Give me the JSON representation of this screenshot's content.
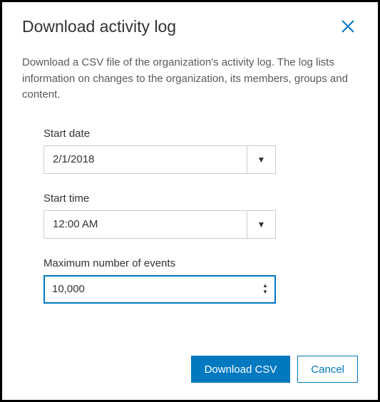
{
  "dialog": {
    "title": "Download activity log",
    "description": "Download a CSV file of the organization's activity log. The log lists information on changes to the organization, its members, groups and content."
  },
  "fields": {
    "start_date": {
      "label": "Start date",
      "value": "2/1/2018"
    },
    "start_time": {
      "label": "Start time",
      "value": "12:00 AM"
    },
    "max_events": {
      "label": "Maximum number of events",
      "value": "10,000"
    }
  },
  "actions": {
    "download": "Download CSV",
    "cancel": "Cancel"
  }
}
